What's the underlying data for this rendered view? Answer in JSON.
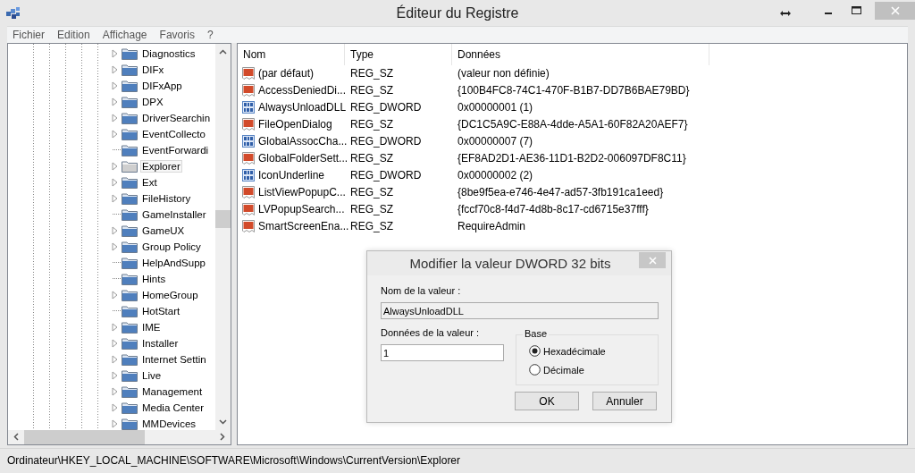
{
  "window": {
    "title": "Éditeur du Registre"
  },
  "menu": [
    "Fichier",
    "Edition",
    "Affichage",
    "Favoris",
    "?"
  ],
  "tree": {
    "items": [
      {
        "label": "Diagnostics",
        "expandable": true,
        "selected": false
      },
      {
        "label": "DIFx",
        "expandable": true,
        "selected": false
      },
      {
        "label": "DIFxApp",
        "expandable": true,
        "selected": false
      },
      {
        "label": "DPX",
        "expandable": true,
        "selected": false
      },
      {
        "label": "DriverSearchin",
        "expandable": true,
        "selected": false
      },
      {
        "label": "EventCollecto",
        "expandable": true,
        "selected": false
      },
      {
        "label": "EventForwardi",
        "expandable": false,
        "selected": false
      },
      {
        "label": "Explorer",
        "expandable": true,
        "selected": true
      },
      {
        "label": "Ext",
        "expandable": true,
        "selected": false
      },
      {
        "label": "FileHistory",
        "expandable": true,
        "selected": false
      },
      {
        "label": "GameInstaller",
        "expandable": false,
        "selected": false
      },
      {
        "label": "GameUX",
        "expandable": true,
        "selected": false
      },
      {
        "label": "Group Policy",
        "expandable": true,
        "selected": false
      },
      {
        "label": "HelpAndSupp",
        "expandable": false,
        "selected": false
      },
      {
        "label": "Hints",
        "expandable": false,
        "selected": false
      },
      {
        "label": "HomeGroup",
        "expandable": true,
        "selected": false
      },
      {
        "label": "HotStart",
        "expandable": false,
        "selected": false
      },
      {
        "label": "IME",
        "expandable": true,
        "selected": false
      },
      {
        "label": "Installer",
        "expandable": true,
        "selected": false
      },
      {
        "label": "Internet Settin",
        "expandable": true,
        "selected": false
      },
      {
        "label": "Live",
        "expandable": true,
        "selected": false
      },
      {
        "label": "Management",
        "expandable": true,
        "selected": false
      },
      {
        "label": "Media Center",
        "expandable": true,
        "selected": false
      },
      {
        "label": "MMDevices",
        "expandable": true,
        "selected": false
      }
    ]
  },
  "table": {
    "columns": [
      "Nom",
      "Type",
      "Données"
    ],
    "rows": [
      {
        "kind": "sz",
        "name": "(par défaut)",
        "type": "REG_SZ",
        "data": "(valeur non définie)"
      },
      {
        "kind": "sz",
        "name": "AccessDeniedDi...",
        "type": "REG_SZ",
        "data": "{100B4FC8-74C1-470F-B1B7-DD7B6BAE79BD}"
      },
      {
        "kind": "dword",
        "name": "AlwaysUnloadDLL",
        "type": "REG_DWORD",
        "data": "0x00000001 (1)"
      },
      {
        "kind": "sz",
        "name": "FileOpenDialog",
        "type": "REG_SZ",
        "data": "{DC1C5A9C-E88A-4dde-A5A1-60F82A20AEF7}"
      },
      {
        "kind": "dword",
        "name": "GlobalAssocCha...",
        "type": "REG_DWORD",
        "data": "0x00000007 (7)"
      },
      {
        "kind": "sz",
        "name": "GlobalFolderSett...",
        "type": "REG_SZ",
        "data": "{EF8AD2D1-AE36-11D1-B2D2-006097DF8C11}"
      },
      {
        "kind": "dword",
        "name": "IconUnderline",
        "type": "REG_DWORD",
        "data": "0x00000002 (2)"
      },
      {
        "kind": "sz",
        "name": "ListViewPopupC...",
        "type": "REG_SZ",
        "data": "{8be9f5ea-e746-4e47-ad57-3fb191ca1eed}"
      },
      {
        "kind": "sz",
        "name": "LVPopupSearch...",
        "type": "REG_SZ",
        "data": "{fccf70c8-f4d7-4d8b-8c17-cd6715e37fff}"
      },
      {
        "kind": "sz",
        "name": "SmartScreenEna...",
        "type": "REG_SZ",
        "data": "RequireAdmin"
      }
    ]
  },
  "dialog": {
    "title": "Modifier la valeur DWORD 32 bits",
    "name_label": "Nom de la valeur :",
    "name_value": "AlwaysUnloadDLL",
    "data_label": "Données de la valeur :",
    "data_value": "1",
    "base_label": "Base",
    "bases": [
      {
        "label": "Hexadécimale",
        "selected": true
      },
      {
        "label": "Décimale",
        "selected": false
      }
    ],
    "buttons": [
      "OK",
      "Annuler"
    ]
  },
  "status_bar": "Ordinateur\\HKEY_LOCAL_MACHINE\\SOFTWARE\\Microsoft\\Windows\\CurrentVersion\\Explorer"
}
